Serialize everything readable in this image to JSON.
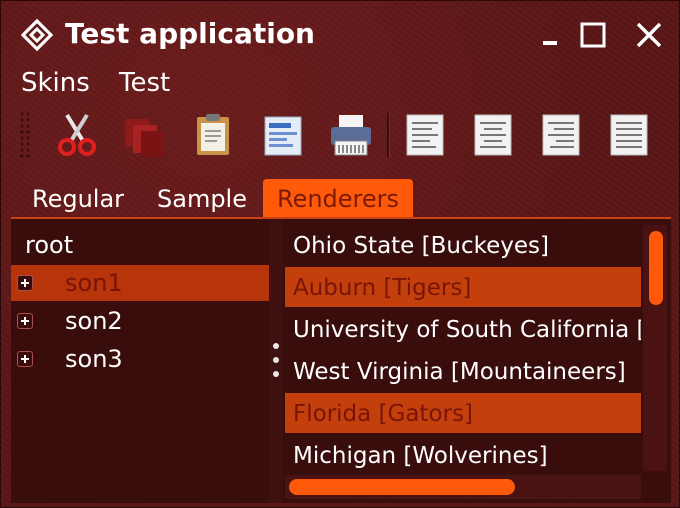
{
  "window": {
    "title": "Test application",
    "icon": "diamond-app-icon",
    "controls": [
      "minimize-icon",
      "maximize-icon",
      "close-icon"
    ]
  },
  "menu": {
    "items": [
      "Skins",
      "Test"
    ]
  },
  "toolbar": {
    "buttons": [
      "cut-icon",
      "copy-icon",
      "paste-icon",
      "edit-doc-icon",
      "print-icon",
      "align-left-icon",
      "align-center-icon",
      "align-right-icon",
      "justify-icon"
    ]
  },
  "tabs": {
    "items": [
      "Regular",
      "Sample",
      "Renderers"
    ],
    "selected": "Renderers"
  },
  "tree": {
    "root": "root",
    "children": [
      "son1",
      "son2",
      "son3"
    ],
    "selected": "son1"
  },
  "list": {
    "items": [
      "Ohio State [Buckeyes]",
      "Auburn [Tigers]",
      "University of South California [Trojans]",
      "West Virginia [Mountaineers]",
      "Florida [Gators]",
      "Michigan [Wolverines]"
    ],
    "selected": [
      "Auburn [Tigers]",
      "Florida [Gators]"
    ]
  },
  "colors": {
    "background": "#5a1616",
    "accent": "#ff5a0a",
    "selection": "#b8340a",
    "panel": "#3a0d0d"
  }
}
